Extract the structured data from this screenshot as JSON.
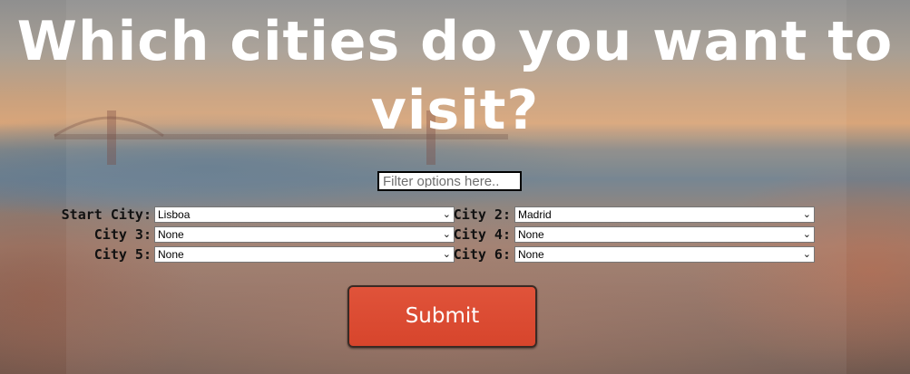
{
  "title": "Which cities do you want to visit?",
  "filter": {
    "placeholder": "Filter options here.."
  },
  "fields": [
    {
      "label": "Start City:",
      "value": "Lisboa"
    },
    {
      "label": "City 2:",
      "value": "Madrid"
    },
    {
      "label": "City 3:",
      "value": "None"
    },
    {
      "label": "City 4:",
      "value": "None"
    },
    {
      "label": "City 5:",
      "value": "None"
    },
    {
      "label": "City 6:",
      "value": "None"
    }
  ],
  "submit": {
    "label": "Submit"
  },
  "colors": {
    "submit_bg": "#d9482f",
    "title": "#ffffff"
  },
  "icons": {
    "dropdown": "chevron-down-icon"
  }
}
